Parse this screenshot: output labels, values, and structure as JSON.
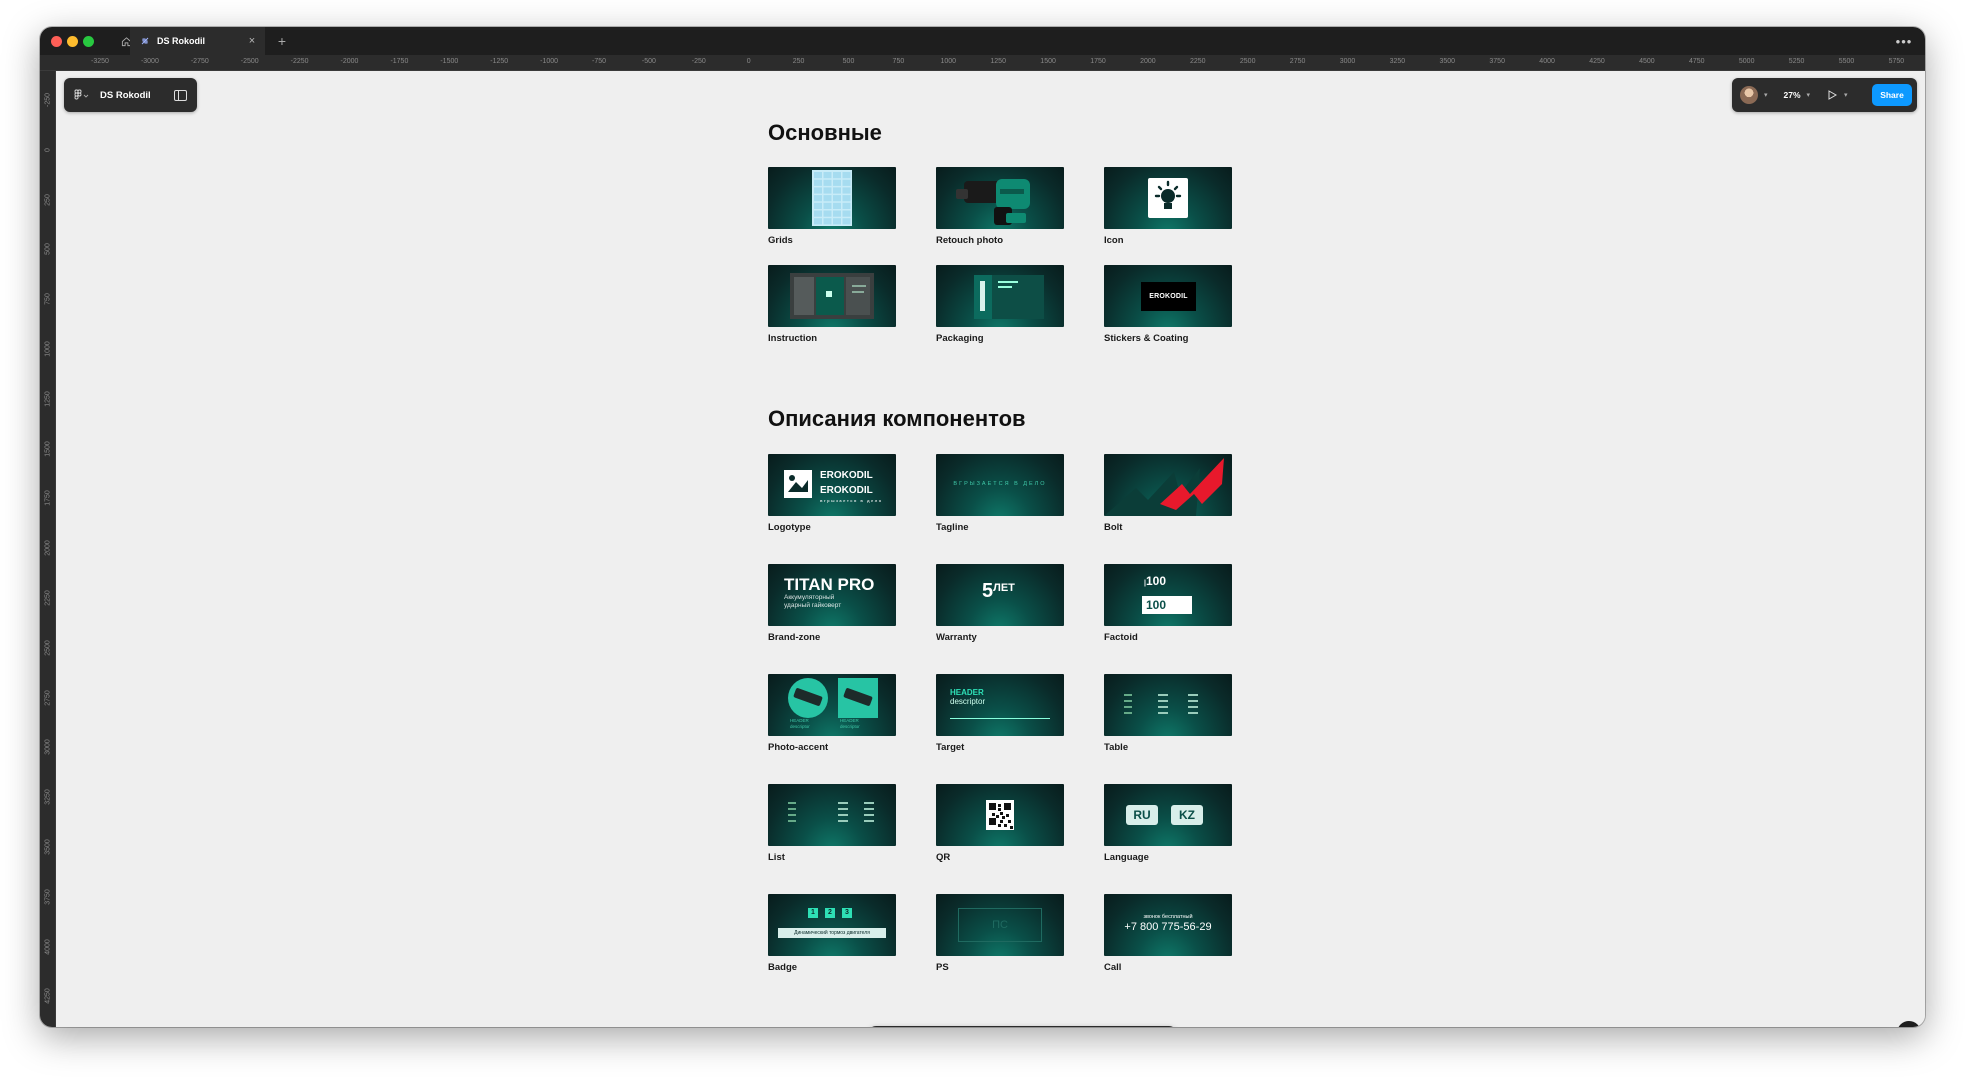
{
  "window": {
    "tab_title": "DS Rokodil",
    "file_name": "DS Rokodil",
    "zoom": "27%",
    "share_label": "Share",
    "help_label": "?"
  },
  "ruler_top": [
    "-3250",
    "-3000",
    "-2750",
    "-2500",
    "-2250",
    "-2000",
    "-1750",
    "-1500",
    "-1250",
    "-1000",
    "-750",
    "-500",
    "-250",
    "0",
    "250",
    "500",
    "750",
    "1000",
    "1250",
    "1500",
    "1750",
    "2000",
    "2250",
    "2500",
    "2750",
    "3000",
    "3250",
    "3500",
    "3750",
    "4000",
    "4250",
    "4500",
    "4750",
    "5000",
    "5250",
    "5500",
    "5750"
  ],
  "ruler_left": [
    "-250",
    "0",
    "250",
    "500",
    "750",
    "1000",
    "1250",
    "1500",
    "1750",
    "2000",
    "2250",
    "2500",
    "2750",
    "3000",
    "3250",
    "3500",
    "3750",
    "4000",
    "4250"
  ],
  "sections": [
    {
      "title": "Основные",
      "cards": [
        {
          "label": "Grids"
        },
        {
          "label": "Retouch photo"
        },
        {
          "label": "Icon"
        },
        {
          "label": "Instruction"
        },
        {
          "label": "Packaging"
        },
        {
          "label": "Stickers & Coating"
        }
      ]
    },
    {
      "title": "Описания компонентов",
      "cards": [
        {
          "label": "Logotype"
        },
        {
          "label": "Tagline"
        },
        {
          "label": "Bolt"
        },
        {
          "label": "Brand-zone"
        },
        {
          "label": "Warranty"
        },
        {
          "label": "Factoid"
        },
        {
          "label": "Photo-accent"
        },
        {
          "label": "Target"
        },
        {
          "label": "Table"
        },
        {
          "label": "List"
        },
        {
          "label": "QR"
        },
        {
          "label": "Language"
        },
        {
          "label": "Badge"
        },
        {
          "label": "PS"
        },
        {
          "label": "Call"
        }
      ]
    }
  ],
  "thumb_text": {
    "brand": "ROKODIL",
    "brand_e": "E",
    "tagline": "вгрызается в дело",
    "titan": "TITAN PRO",
    "titan_sub1": "Аккумуляторный",
    "titan_sub2": "ударный гайковерт",
    "warranty_num": "5",
    "warranty_word": "ЛЕТ",
    "factoid_num": "100",
    "photo_header": "HEADER",
    "photo_desc": "descriptor",
    "target_header": "HEADER",
    "target_desc": "descriptor",
    "lang_ru": "RU",
    "lang_kz": "KZ",
    "badge_1": "1",
    "badge_2": "2",
    "badge_3": "3",
    "badge_text": "Динамический тормоз двигателя",
    "ps_text": "ПС",
    "call_small": "звонок бесплатный",
    "call_number": "+7 800 775-56-29"
  },
  "colors": {
    "accent": "#0d99ff",
    "thumb_dark": "#0a2b2a",
    "thumb_teal": "#0f7a6a",
    "bolt_red": "#e8192c"
  }
}
